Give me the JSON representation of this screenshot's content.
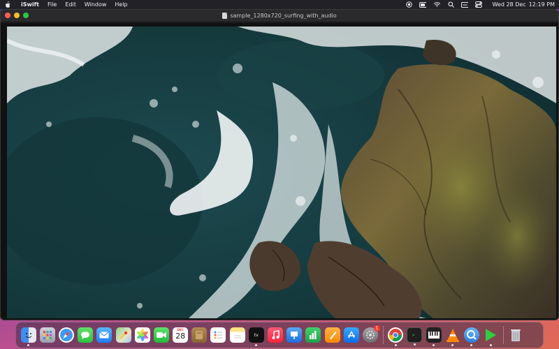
{
  "menubar": {
    "app_name": "iSwift",
    "menus": [
      "File",
      "Edit",
      "Window",
      "Help"
    ],
    "clock": {
      "date": "Wed 28 Dec",
      "time": "12:19 PM"
    }
  },
  "window": {
    "title": "sample_1280x720_surfing_with_audio"
  },
  "dock": {
    "calendar": {
      "month": "DEC",
      "day": "28"
    },
    "settings_badge": "1",
    "apps": [
      {
        "name": "Finder"
      },
      {
        "name": "Launchpad"
      },
      {
        "name": "Safari"
      },
      {
        "name": "Messages"
      },
      {
        "name": "Mail"
      },
      {
        "name": "Maps"
      },
      {
        "name": "Photos"
      },
      {
        "name": "FaceTime"
      },
      {
        "name": "Calendar"
      },
      {
        "name": "Notes Brown"
      },
      {
        "name": "Reminders"
      },
      {
        "name": "Notes"
      },
      {
        "name": "Apple TV"
      },
      {
        "name": "Music"
      },
      {
        "name": "Keynote"
      },
      {
        "name": "Numbers"
      },
      {
        "name": "Pages"
      },
      {
        "name": "App Store"
      },
      {
        "name": "System Settings"
      },
      {
        "name": "Chrome"
      },
      {
        "name": "Terminal"
      },
      {
        "name": "Piano"
      },
      {
        "name": "VLC"
      },
      {
        "name": "QuickTime"
      },
      {
        "name": "iSwift"
      },
      {
        "name": "Trash"
      }
    ]
  }
}
